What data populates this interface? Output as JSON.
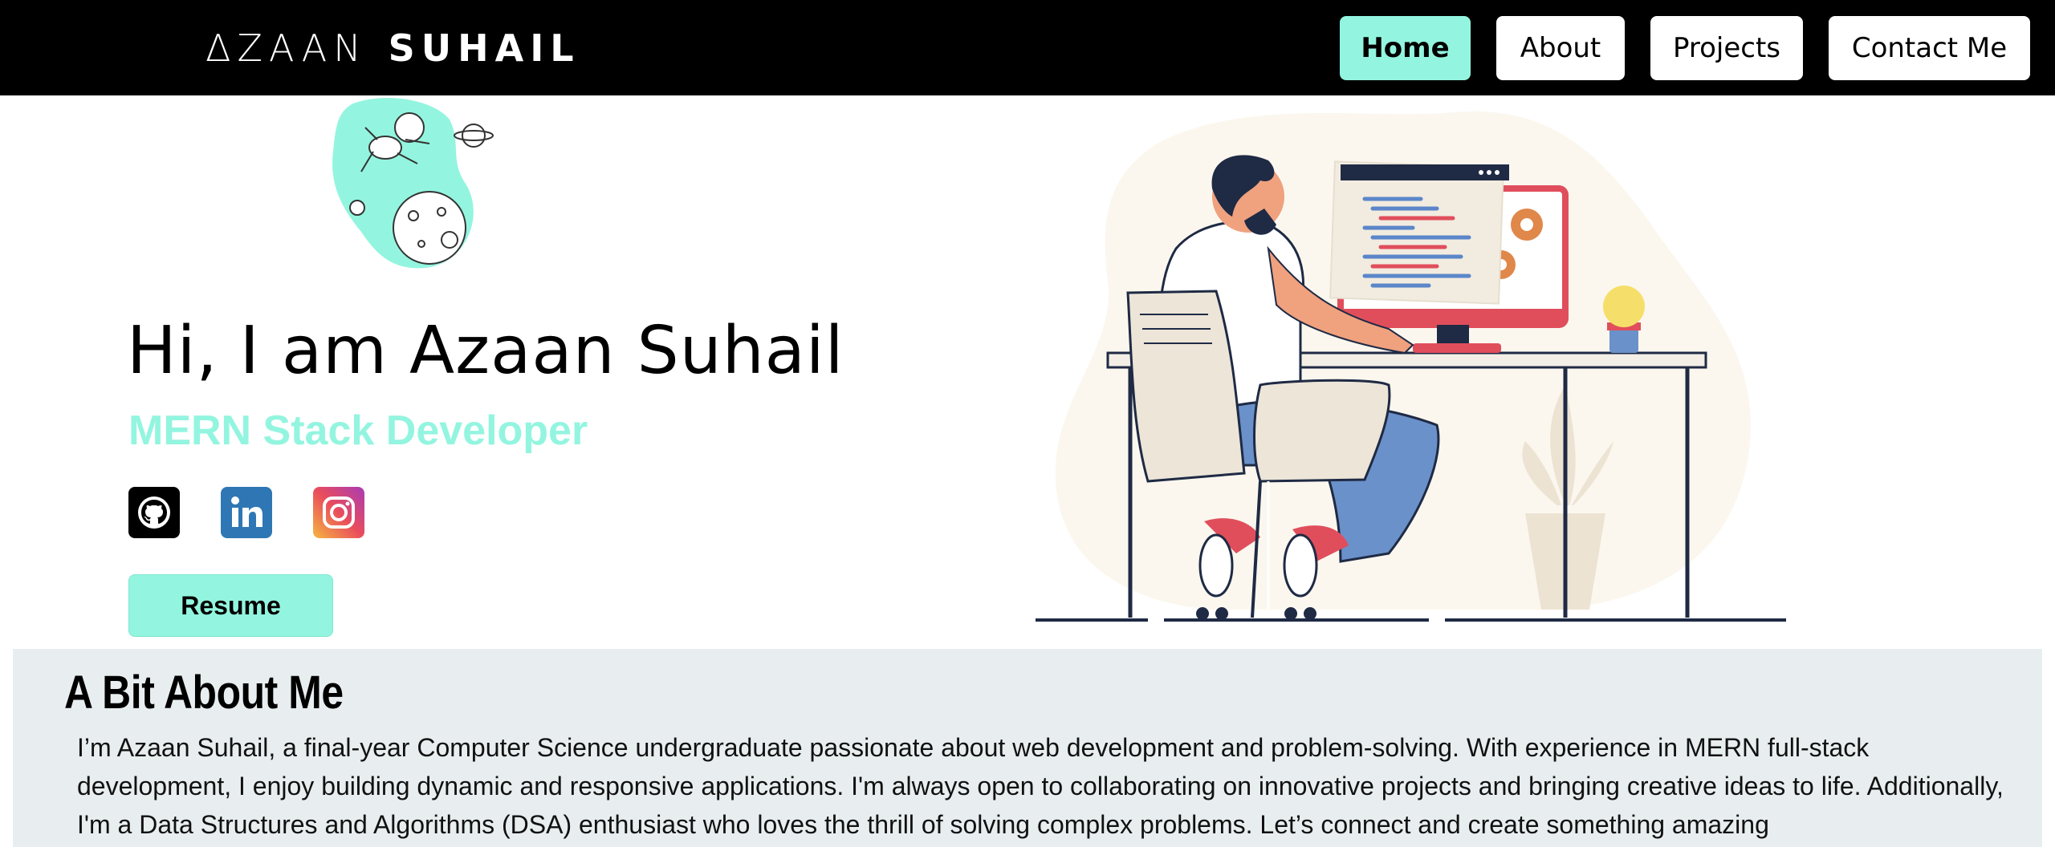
{
  "navbar": {
    "brand_first": "ΔZAAN",
    "brand_second": "SUHAIL",
    "items": [
      {
        "label": "Home",
        "active": true
      },
      {
        "label": "About",
        "active": false
      },
      {
        "label": "Projects",
        "active": false
      },
      {
        "label": "Contact Me",
        "active": false
      }
    ]
  },
  "hero": {
    "title": "Hi, I am Azaan Suhail",
    "subtitle": "MERN Stack Developer",
    "socials": [
      {
        "icon": "github-icon"
      },
      {
        "icon": "linkedin-icon"
      },
      {
        "icon": "instagram-icon"
      }
    ],
    "resume_label": "Resume"
  },
  "about": {
    "title": "A Bit About Me",
    "text": "I’m Azaan Suhail, a final-year Computer Science undergraduate passionate about web development and problem-solving. With experience in MERN full-stack development, I enjoy building dynamic and responsive applications. I'm always open to collaborating on innovative projects and bringing creative ideas to life. Additionally, I'm a Data Structures and Algorithms (DSA) enthusiast who loves the thrill of solving complex problems. Let’s connect and create something amazing"
  },
  "colors": {
    "accent": "#93f5df",
    "navbar_bg": "#000000",
    "about_bg": "#e8eef0",
    "linkedin": "#2f77b4"
  }
}
